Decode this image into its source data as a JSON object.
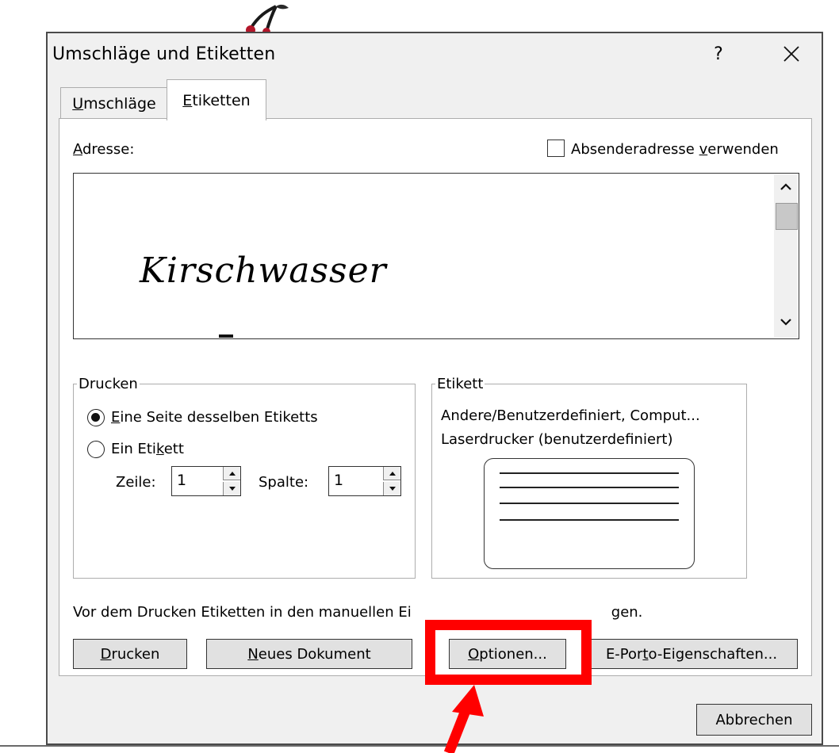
{
  "window": {
    "title": "Umschläge und Etiketten",
    "help_label": "?",
    "close_icon": "close-icon"
  },
  "tabs": [
    {
      "label": "Umschläge",
      "mnemonic": "U",
      "rest": "mschläge",
      "active": false
    },
    {
      "label": "Etiketten",
      "mnemonic": "E",
      "rest": "tiketten",
      "active": true
    }
  ],
  "address": {
    "label": "Adresse:",
    "label_mnemonic": "A",
    "label_rest": "dresse:",
    "value": "Kirschwasser",
    "use_sender_label_pre": "Absenderadresse ",
    "use_sender_label_mnemonic": "v",
    "use_sender_label_post": "erwenden",
    "use_sender_checked": false
  },
  "print_group": {
    "legend": "Drucken",
    "option_full_page": {
      "pre": "E",
      "rest": "ine Seite desselben Etiketts",
      "selected": true
    },
    "option_single": {
      "pre": "Ein Eti",
      "mn": "k",
      "post": "ett",
      "selected": false
    },
    "row_label": "Zeile:",
    "row_value": "1",
    "col_label": "Spalte:",
    "col_value": "1"
  },
  "label_group": {
    "legend": "Etikett",
    "line1": "Andere/Benutzerdefiniert, Comput...",
    "line2": "Laserdrucker (benutzerdefiniert)"
  },
  "info_text": "Vor dem Drucken Etiketten in den manuellen Ei",
  "info_text_tail": "gen.",
  "buttons": {
    "print": {
      "mn": "D",
      "rest": "rucken"
    },
    "new_document": {
      "mn": "N",
      "rest": "eues Dokument"
    },
    "options": {
      "mn": "O",
      "rest": "ptionen..."
    },
    "eporto": {
      "pre": "E-Por",
      "mn": "t",
      "post": "o-Eigenschaften..."
    },
    "cancel": "Abbrechen"
  },
  "annotation": {
    "color": "#ff0000",
    "target": "Optionen..."
  }
}
